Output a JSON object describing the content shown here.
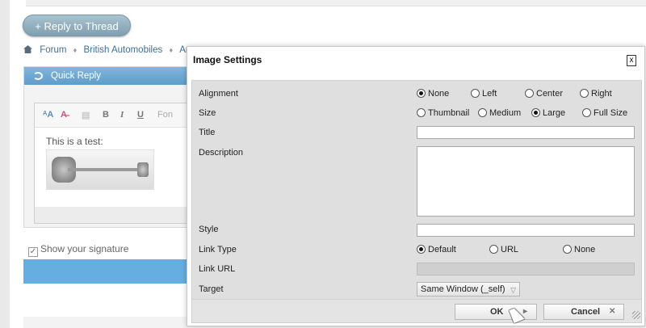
{
  "forum": {
    "reply_button": "+ Reply to Thread",
    "breadcrumb": [
      "Forum",
      "British Automobiles",
      "Ar"
    ],
    "quick_reply_title": "Quick Reply",
    "toolbar_bold": "B",
    "toolbar_italic": "I",
    "toolbar_underline": "U",
    "toolbar_font": "Fon",
    "editor_text": "This is a test:",
    "show_signature": "Show your signature"
  },
  "dialog": {
    "title": "Image Settings",
    "close_label": "x",
    "labels": {
      "alignment": "Alignment",
      "size": "Size",
      "title": "Title",
      "description": "Description",
      "style": "Style",
      "link_type": "Link Type",
      "link_url": "Link URL",
      "target": "Target"
    },
    "alignment_options": [
      "None",
      "Left",
      "Center",
      "Right"
    ],
    "alignment_selected": "None",
    "size_options": [
      "Thumbnail",
      "Medium",
      "Large",
      "Full Size"
    ],
    "size_selected": "Large",
    "link_type_options": [
      "Default",
      "URL",
      "None"
    ],
    "link_type_selected": "Default",
    "title_value": "",
    "description_value": "",
    "style_value": "",
    "link_url_value": "",
    "target_selected": "Same Window (_self)",
    "ok_label": "OK",
    "cancel_label": "Cancel"
  },
  "colors": {
    "quick_reply_header": "#5f9dc9",
    "reply_button": "#8aa9ba",
    "link": "#3f6f9c"
  }
}
